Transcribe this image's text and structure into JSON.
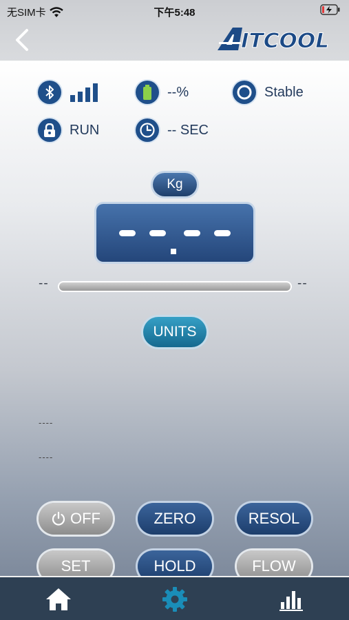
{
  "status_bar": {
    "carrier": "无SIM卡",
    "time": "下午5:48",
    "battery_state": "charging"
  },
  "header": {
    "back_icon": "chevron-left-icon",
    "logo_text": "AITCOOL"
  },
  "status": {
    "bluetooth_icon": "bluetooth-icon",
    "signal_bars": 4,
    "battery_icon": "battery-icon",
    "battery_value": "--%",
    "stability_icon": "target-icon",
    "stability": "Stable",
    "lock_icon": "lock-icon",
    "mode": "RUN",
    "timer_icon": "clock-icon",
    "timer": "-- SEC"
  },
  "display": {
    "unit": "Kg",
    "reading": "----"
  },
  "range_bar": {
    "min_label": "--",
    "max_label": "--",
    "fill_fraction": 0
  },
  "units_button": "UNITS",
  "readouts": [
    "----",
    "----"
  ],
  "buttons": {
    "off": "OFF",
    "zero": "ZERO",
    "resol": "RESOL",
    "set": "SET",
    "hold": "HOLD",
    "flow": "FLOW"
  },
  "colors": {
    "navy": "#1f3f6b",
    "accent_teal": "#1a8db8",
    "tabbar": "#2e4053"
  },
  "tabs": [
    {
      "icon": "home-icon",
      "active": false
    },
    {
      "icon": "gear-icon",
      "active": true
    },
    {
      "icon": "bar-chart-icon",
      "active": false
    }
  ]
}
